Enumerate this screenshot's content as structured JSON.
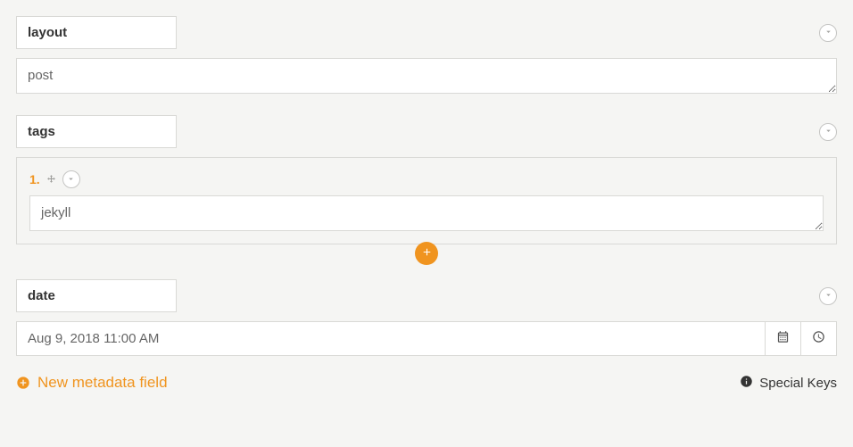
{
  "fields": {
    "layout": {
      "key": "layout",
      "value": "post"
    },
    "tags": {
      "key": "tags",
      "items": [
        {
          "index": "1.",
          "value": "jekyll"
        }
      ]
    },
    "date": {
      "key": "date",
      "value": "Aug 9, 2018 11:00 AM"
    }
  },
  "actions": {
    "new_field": "New metadata field",
    "special_keys": "Special Keys"
  }
}
